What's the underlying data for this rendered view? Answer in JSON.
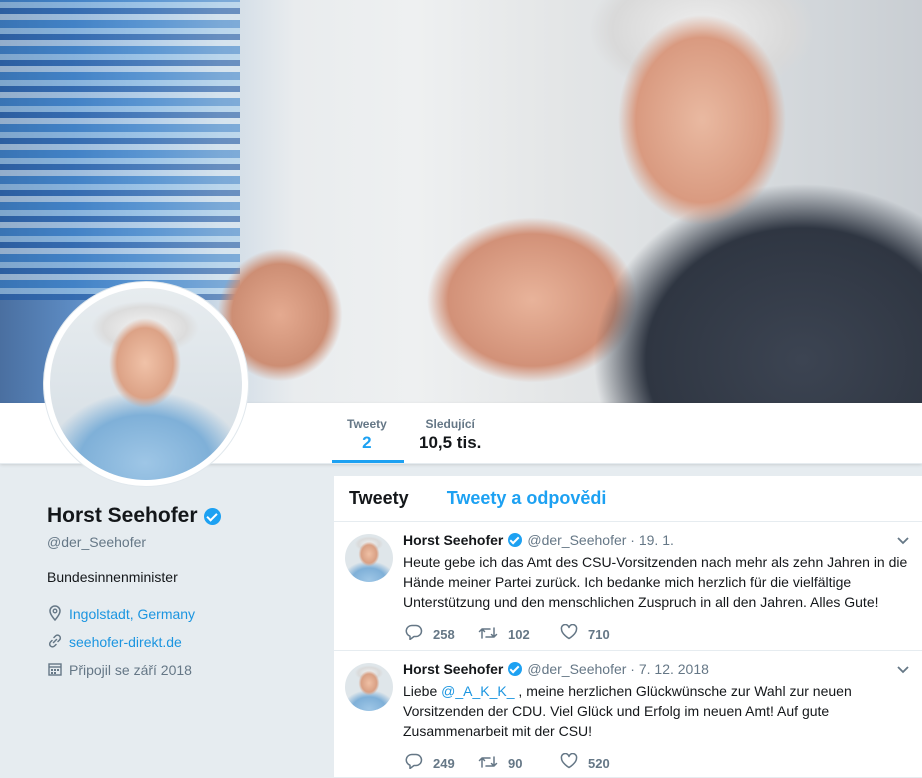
{
  "colors": {
    "accent": "#1da1f2",
    "link": "#1b95e0",
    "muted": "#657786",
    "text": "#14171a"
  },
  "nav": {
    "tweets_label": "Tweety",
    "tweets_count": "2",
    "following_label": "Sledující",
    "following_count": "10,5 tis."
  },
  "profile": {
    "name": "Horst Seehofer",
    "handle": "@der_Seehofer",
    "bio": "Bundesinnenminister",
    "location": "Ingolstadt, Germany",
    "website": "seehofer-direkt.de",
    "joined": "Připojil se září 2018",
    "icons": {
      "location": "location-pin-icon",
      "website": "link-icon",
      "joined": "calendar-icon"
    }
  },
  "timeline": {
    "tabs": [
      "Tweety",
      "Tweety a odpovědi"
    ],
    "tweets": [
      {
        "name": "Horst Seehofer",
        "meta": "@der_Seehofer · 19. 1.",
        "text": "Heute gebe ich das Amt des CSU-Vorsitzenden nach mehr als zehn Jahren in die Hände meiner Partei zurück. Ich bedanke mich herzlich für die vielfältige Unterstützung und den menschlichen Zuspruch in all den Jahren. Alles Gute!",
        "replies": "258",
        "retweets": "102",
        "likes": "710"
      },
      {
        "name": "Horst Seehofer",
        "meta": "@der_Seehofer · 7. 12. 2018",
        "text_prefix": "Liebe ",
        "mention": "@_A_K_K_",
        "text_suffix": " , meine herzlichen Glückwünsche zur Wahl zur neuen Vorsitzenden der CDU. Viel Glück und Erfolg im neuen Amt! Auf gute Zusammenarbeit mit der CSU!",
        "replies": "249",
        "retweets": "90",
        "likes": "520"
      }
    ]
  }
}
